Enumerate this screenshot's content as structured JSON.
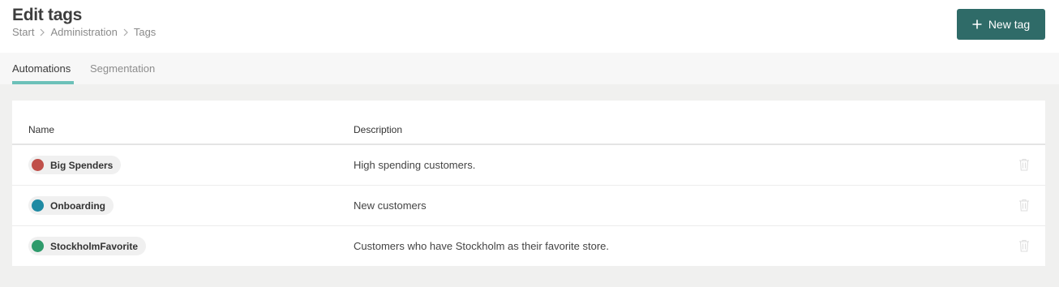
{
  "header": {
    "title": "Edit tags",
    "breadcrumb": [
      "Start",
      "Administration",
      "Tags"
    ],
    "new_tag_label": "New tag"
  },
  "tabs": [
    {
      "label": "Automations",
      "active": true
    },
    {
      "label": "Segmentation",
      "active": false
    }
  ],
  "table": {
    "columns": [
      "Name",
      "Description"
    ],
    "rows": [
      {
        "name": "Big Spenders",
        "color": "#c0504a",
        "description": "High spending customers."
      },
      {
        "name": "Onboarding",
        "color": "#1f8aa3",
        "description": "New customers"
      },
      {
        "name": "StockholmFavorite",
        "color": "#2e9a6b",
        "description": "Customers who have Stockholm as their favorite store."
      }
    ]
  },
  "icons": {
    "new_tag": "plus-icon",
    "breadcrumb_separator": "chevron-right-icon",
    "row_action": "trash-icon"
  },
  "colors": {
    "primary_button": "#2f6b68",
    "tab_indicator": "#6cc1b9"
  }
}
